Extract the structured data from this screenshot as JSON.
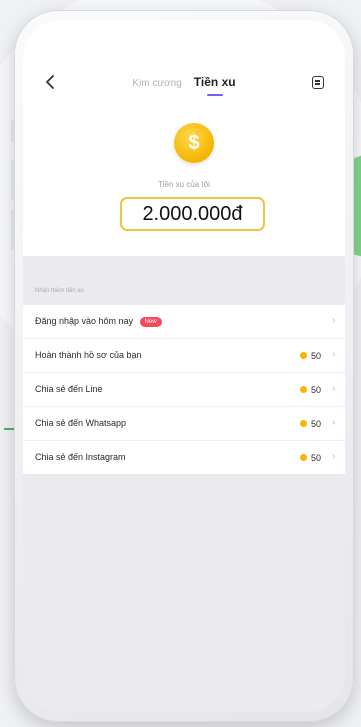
{
  "colors": {
    "accent_tab_underline": "#7a5cf0",
    "coin": "#f5b400",
    "balance_border": "#f2c340",
    "new_badge": "#f24b5b",
    "beam_green": "#5fc86e"
  },
  "header": {
    "back_icon": "chevron-left-icon",
    "tabs": [
      {
        "label": "Kim cương",
        "active": false
      },
      {
        "label": "Tiền xu",
        "active": true
      }
    ],
    "right_icon": "note-icon"
  },
  "wallet": {
    "coin_icon_text": "$",
    "label": "Tiền xu của tôi",
    "balance": "2.000.000đ"
  },
  "earn": {
    "section_title": "Nhận thêm tiền xu",
    "items": [
      {
        "label": "Đăng nhập vào hôm nay",
        "badge": "New",
        "reward": ""
      },
      {
        "label": "Hoàn thành hồ sơ của bạn",
        "badge": "",
        "reward": "50"
      },
      {
        "label": "Chia sẻ đến Line",
        "badge": "",
        "reward": "50"
      },
      {
        "label": "Chia sẻ đến Whatsapp",
        "badge": "",
        "reward": "50"
      },
      {
        "label": "Chia sẻ đến Instagram",
        "badge": "",
        "reward": "50"
      }
    ],
    "chevron": "›"
  }
}
